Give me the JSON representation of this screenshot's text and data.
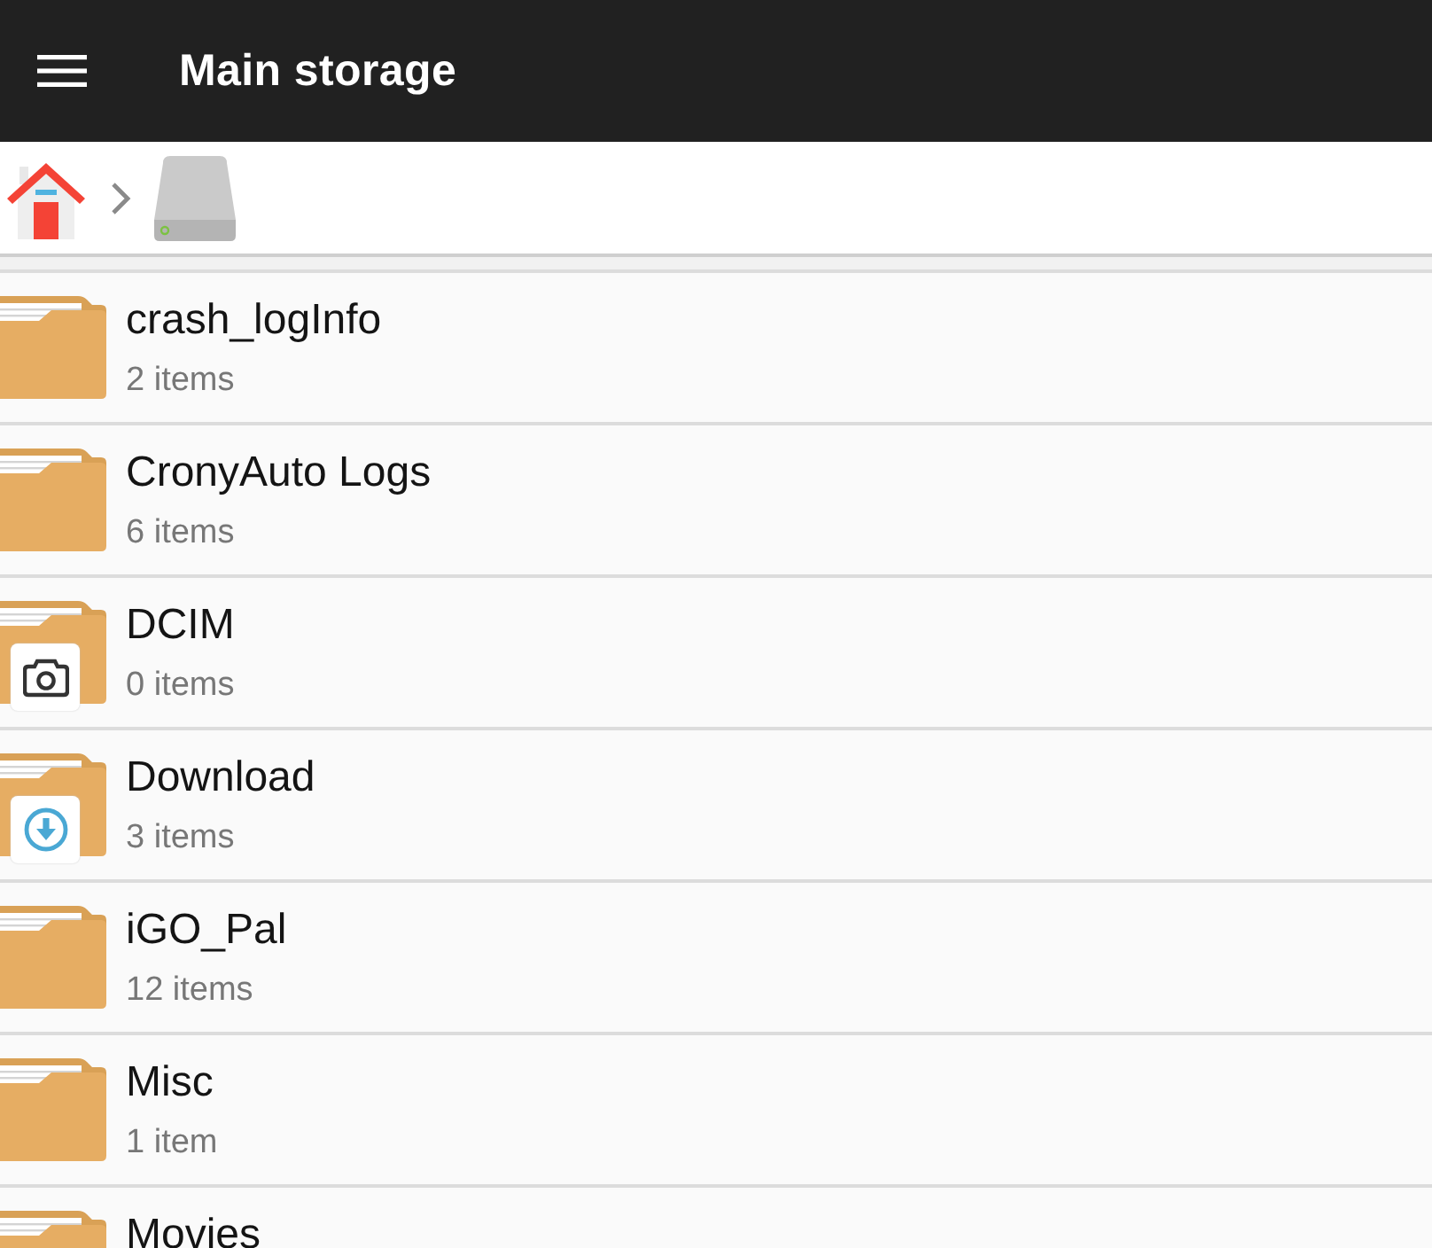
{
  "app_bar": {
    "title": "Main storage"
  },
  "folders": [
    {
      "name": "crash_logInfo",
      "count": "2 items",
      "kind": "plain"
    },
    {
      "name": "CronyAuto Logs",
      "count": "6 items",
      "kind": "plain"
    },
    {
      "name": "DCIM",
      "count": "0 items",
      "kind": "camera"
    },
    {
      "name": "Download",
      "count": "3 items",
      "kind": "download"
    },
    {
      "name": "iGO_Pal",
      "count": "12 items",
      "kind": "plain"
    },
    {
      "name": "Misc",
      "count": "1 item",
      "kind": "plain"
    },
    {
      "name": "Movies",
      "kind": "plain"
    }
  ]
}
